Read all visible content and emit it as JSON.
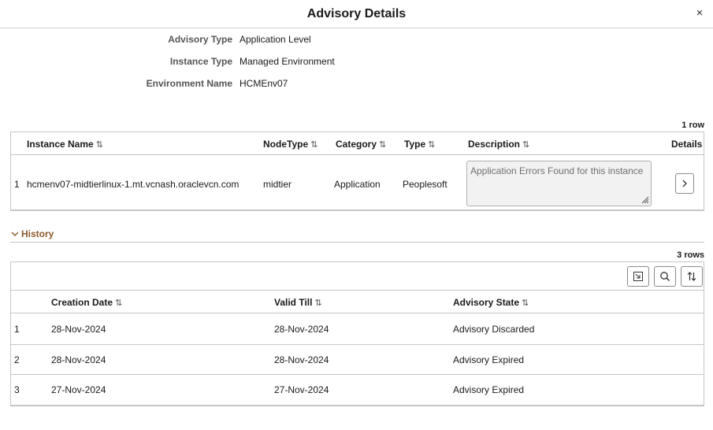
{
  "dialog": {
    "title": "Advisory Details",
    "close_label": "×"
  },
  "fields": [
    {
      "label": "Advisory Type",
      "value": "Application Level"
    },
    {
      "label": "Instance Type",
      "value": "Managed Environment"
    },
    {
      "label": "Environment Name",
      "value": "HCMEnv07"
    }
  ],
  "instances": {
    "row_count": "1 row",
    "columns": {
      "instance_name": "Instance Name",
      "node_type": "NodeType",
      "category": "Category",
      "type": "Type",
      "description": "Description",
      "details": "Details"
    },
    "sort_glyph": "⇅",
    "rows": [
      {
        "num": "1",
        "instance_name": "hcmenv07-midtierlinux-1.mt.vcnash.oraclevcn.com",
        "node_type": "midtier",
        "category": "Application",
        "type": "Peoplesoft",
        "description": "Application Errors Found for this instance"
      }
    ]
  },
  "history": {
    "section_label": "History",
    "row_count": "3 rows",
    "toolbar": [
      "export-icon",
      "search-icon",
      "sort-icon"
    ],
    "columns": {
      "creation_date": "Creation Date",
      "valid_till": "Valid Till",
      "advisory_state": "Advisory State"
    },
    "rows": [
      {
        "num": "1",
        "creation_date": "28-Nov-2024",
        "valid_till": "28-Nov-2024",
        "advisory_state": "Advisory Discarded"
      },
      {
        "num": "2",
        "creation_date": "28-Nov-2024",
        "valid_till": "28-Nov-2024",
        "advisory_state": "Advisory Expired"
      },
      {
        "num": "3",
        "creation_date": "27-Nov-2024",
        "valid_till": "27-Nov-2024",
        "advisory_state": "Advisory Expired"
      }
    ]
  },
  "colors": {
    "section_accent": "#8b5a2b",
    "border": "#c6c6c6",
    "label": "#555555"
  }
}
